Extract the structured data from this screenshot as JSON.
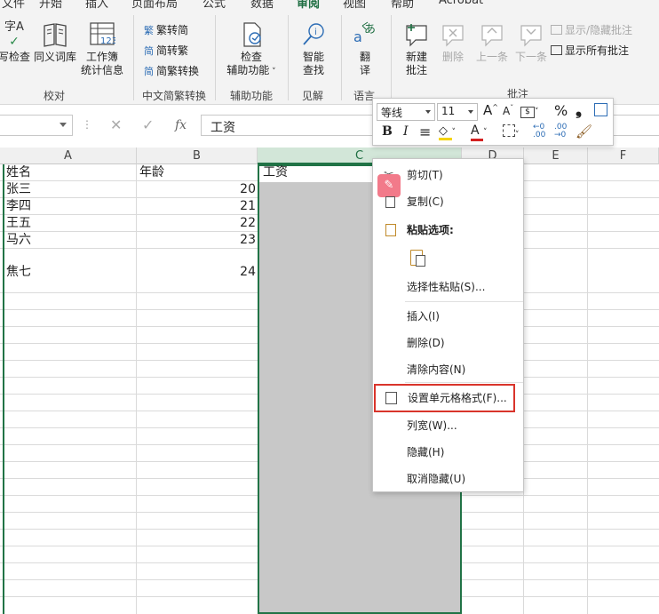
{
  "tabs": [
    "文件",
    "开始",
    "插入",
    "页面布局",
    "公式",
    "数据",
    "审阅",
    "视图",
    "帮助",
    "Acrobat"
  ],
  "active_tab": "审阅",
  "ribbon": {
    "spelling_top": "字A",
    "spelling_label": "写检查",
    "thesaurus_label": "同义词库",
    "workbook_stats_line1": "工作簿",
    "workbook_stats_line2": "统计信息",
    "proofing_group": "校对",
    "trad_to_simp": "繁转简",
    "simp_to_trad": "简转繁",
    "conversion": "简繁转换",
    "chinese_group": "中文简繁转换",
    "access_line1": "检查",
    "access_line2": "辅助功能",
    "access_group": "辅助功能",
    "smart_line1": "智能",
    "smart_line2": "查找",
    "insights_group": "见解",
    "translate_line1": "翻",
    "translate_line2": "译",
    "language_group": "语言",
    "new_comment_line1": "新建",
    "new_comment_line2": "批注",
    "delete_label": "删除",
    "previous_label": "上一条",
    "next_label": "下一条",
    "show_hide_comment": "显示/隐藏批注",
    "show_all_comments": "显示所有批注",
    "comments_group": "批注"
  },
  "formula_bar": {
    "cancel_icon": "✕",
    "enter_icon": "✓",
    "fx": "fx",
    "value": "工资"
  },
  "sheet": {
    "columns": [
      "A",
      "B",
      "C",
      "D",
      "E",
      "F"
    ],
    "rows": [
      {
        "a": "姓名",
        "b": "年龄",
        "c": "工资"
      },
      {
        "a": "张三",
        "b": "20"
      },
      {
        "a": "李四",
        "b": "21"
      },
      {
        "a": "王五",
        "b": "22"
      },
      {
        "a": "马六",
        "b": "23"
      },
      {
        "a": "焦七",
        "b": "24"
      }
    ]
  },
  "mini_toolbar": {
    "font_name": "等线",
    "font_size": "11",
    "grow_font": "A",
    "shrink_font": "A",
    "percent": "%",
    "comma": "❟",
    "bold": "B",
    "italic": "I",
    "align": "≡",
    "font_color_glyph": "A",
    "fill_color": "#f5d300",
    "font_color": "#d32020",
    "inc_decimal": "←0\n.00",
    "dec_decimal": ".00\n→0"
  },
  "context_menu": {
    "cut": "剪切(T)",
    "copy": "复制(C)",
    "paste_options": "粘贴选项:",
    "paste_special": "选择性粘贴(S)...",
    "insert": "插入(I)",
    "delete": "删除(D)",
    "clear_contents": "清除内容(N)",
    "format_cells": "设置单元格格式(F)...",
    "column_width": "列宽(W)...",
    "hide": "隐藏(H)",
    "unhide": "取消隐藏(U)"
  },
  "colors": {
    "accent": "#217346",
    "highlight_border": "#d9342b",
    "selected_column_fill": "#c8c8c8"
  }
}
